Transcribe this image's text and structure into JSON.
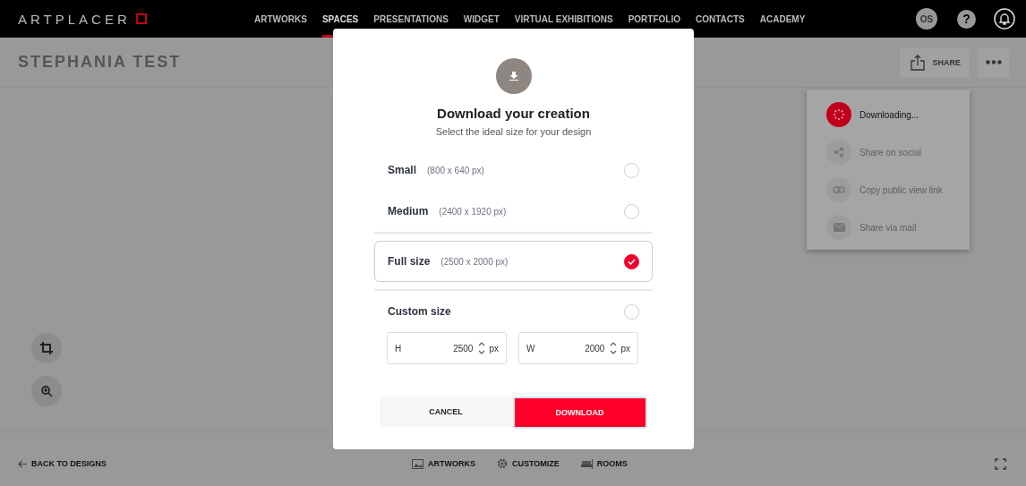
{
  "nav": {
    "logo": "ARTPLACER",
    "items": [
      {
        "label": "ARTWORKS",
        "selected": false
      },
      {
        "label": "SPACES",
        "selected": true
      },
      {
        "label": "PRESENTATIONS",
        "selected": false
      },
      {
        "label": "WIDGET",
        "selected": false
      },
      {
        "label": "VIRTUAL EXHIBITIONS",
        "selected": false
      },
      {
        "label": "PORTFOLIO",
        "selected": false
      },
      {
        "label": "CONTACTS",
        "selected": false
      },
      {
        "label": "ACADEMY",
        "selected": false
      }
    ],
    "avatar": "OS",
    "help": "?"
  },
  "page": {
    "title": "STEPHANIA TEST",
    "share_button": "SHARE",
    "share_menu": [
      {
        "label": "Downloading...",
        "kind": "progress",
        "disabled": false
      },
      {
        "label": "Share on social",
        "kind": "social",
        "disabled": true
      },
      {
        "label": "Copy public view link",
        "kind": "link",
        "disabled": true
      },
      {
        "label": "Share via mail",
        "kind": "mail",
        "disabled": true
      }
    ]
  },
  "bottom_bar": {
    "back": "BACK TO DESIGNS",
    "tabs": [
      {
        "label": "ARTWORKS",
        "kind": "artworks"
      },
      {
        "label": "CUSTOMIZE",
        "kind": "customize"
      },
      {
        "label": "ROOMS",
        "kind": "rooms"
      }
    ]
  },
  "dialog": {
    "title": "Download your creation",
    "subtitle": "Select the ideal size for your design",
    "options": [
      {
        "label": "Small",
        "dims": "(800 x 640 px)",
        "selected": false
      },
      {
        "label": "Medium",
        "dims": "(2400 x 1920 px)",
        "selected": false
      },
      {
        "label": "Full size",
        "dims": "(2500 x 2000 px)",
        "selected": true
      },
      {
        "label": "Custom size",
        "selected": false
      }
    ],
    "custom_fields": [
      {
        "label": "H",
        "value": "2500",
        "unit": "px"
      },
      {
        "label": "W",
        "value": "2000",
        "unit": "px"
      }
    ],
    "cancel": "CANCEL",
    "download": "DOWNLOAD"
  }
}
